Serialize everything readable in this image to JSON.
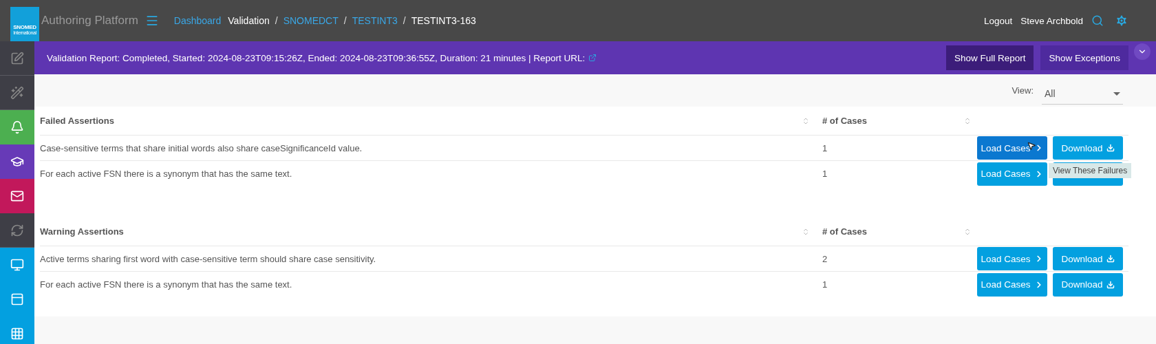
{
  "header": {
    "logo": {
      "name": "SNOMED",
      "subtitle": "International"
    },
    "app_title": "Authoring Platform",
    "breadcrumb": [
      {
        "label": "Dashboard",
        "link": true
      },
      {
        "label": "Validation",
        "link": false
      },
      {
        "label": "SNOMEDCT",
        "link": true,
        "separator": "/"
      },
      {
        "label": "TESTINT3",
        "link": true,
        "separator": "/"
      },
      {
        "label": "TESTINT3-163",
        "link": false,
        "separator": "/"
      }
    ],
    "logout": "Logout",
    "user": "Steve Archbold"
  },
  "sidebar": [
    {
      "color": "#3e3e46"
    },
    {
      "color": "#3e3e46"
    },
    {
      "color": "#4caf50"
    },
    {
      "color": "#673ab7"
    },
    {
      "color": "#c2185b"
    },
    {
      "color": "#3e3e46"
    },
    {
      "color": "#03a0e0"
    },
    {
      "color": "#03a0e0"
    },
    {
      "color": "#03a0e0"
    }
  ],
  "banner": {
    "text": "Validation Report: Completed, Started: 2024-08-23T09:15:26Z, Ended: 2024-08-23T09:36:55Z, Duration: 21 minutes | Report URL:",
    "buttons": [
      {
        "label": "Show Full Report",
        "selected": true
      },
      {
        "label": "Show Exceptions",
        "selected": false
      }
    ]
  },
  "view_filter": {
    "label": "View:",
    "value": "All"
  },
  "tables": [
    {
      "columns": [
        "Failed Assertions",
        "# of Cases"
      ],
      "rows": [
        {
          "assertion": "Case-sensitive terms that share initial words also share caseSignificanceId value.",
          "cases": "1",
          "load": "Load Cases",
          "download": "Download",
          "hovered": true
        },
        {
          "assertion": "For each active FSN there is a synonym that has the same text.",
          "cases": "1",
          "load": "Load Cases",
          "hovered": false
        }
      ]
    },
    {
      "columns": [
        "Warning Assertions",
        "# of Cases"
      ],
      "rows": [
        {
          "assertion": "Active terms sharing first word with case-sensitive term should share case sensitivity.",
          "cases": "2",
          "load": "Load Cases",
          "download": "Download",
          "hovered": false
        },
        {
          "assertion": "For each active FSN there is a synonym that has the same text.",
          "cases": "1",
          "load": "Load Cases",
          "download": "Download",
          "hovered": false
        }
      ]
    }
  ],
  "tooltip": "View These Failures"
}
